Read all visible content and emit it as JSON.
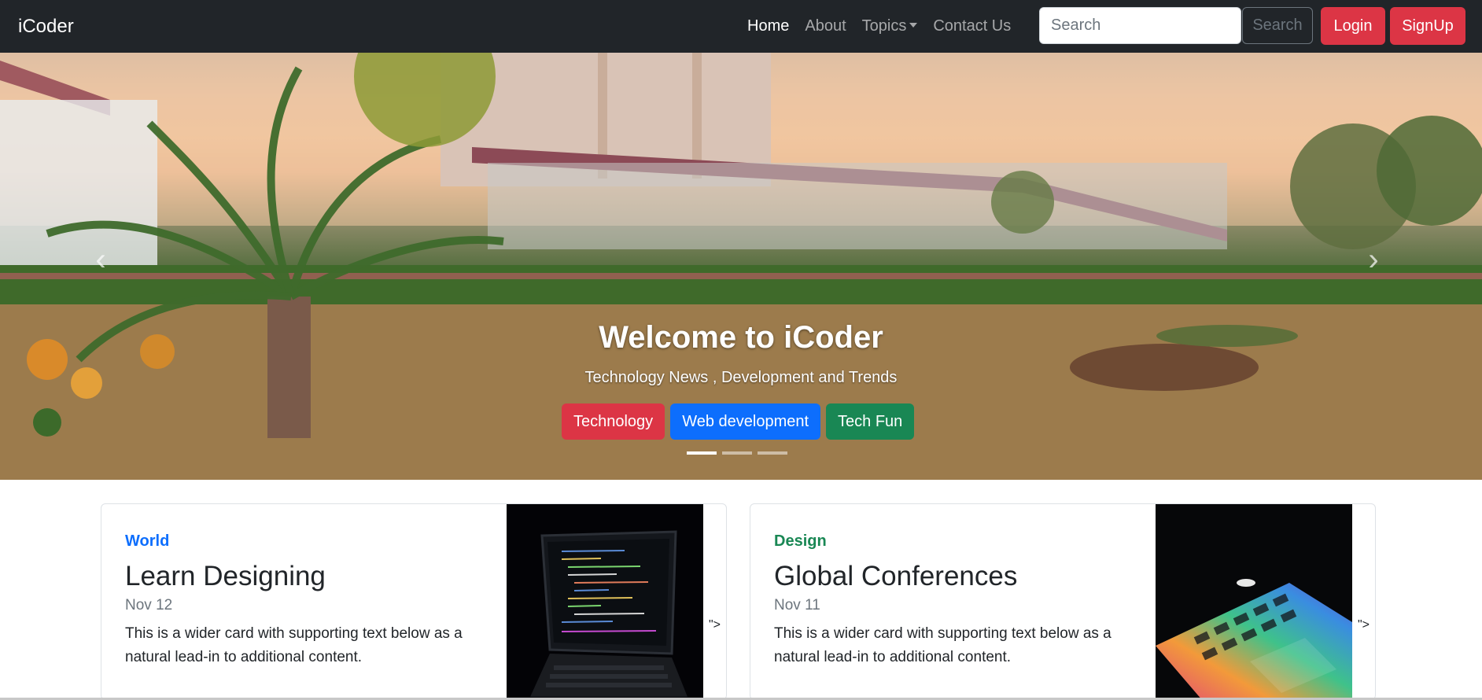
{
  "navbar": {
    "brand": "iCoder",
    "links": [
      {
        "label": "Home",
        "active": true
      },
      {
        "label": "About",
        "active": false
      },
      {
        "label": "Topics",
        "active": false,
        "dropdown": true
      },
      {
        "label": "Contact Us",
        "active": false
      }
    ],
    "search_placeholder": "Search",
    "search_button": "Search",
    "login": "Login",
    "signup": "SignUp"
  },
  "hero": {
    "title": "Welcome to iCoder",
    "subtitle": "Technology News , Development and Trends",
    "buttons": [
      {
        "label": "Technology",
        "color": "#dc3545"
      },
      {
        "label": "Web development",
        "color": "#0d6efd"
      },
      {
        "label": "Tech Fun",
        "color": "#198754"
      }
    ],
    "indicators_total": 3,
    "indicator_active": 1
  },
  "cards": [
    {
      "category": "World",
      "category_color": "#0d6efd",
      "title": "Learn Designing",
      "date": "Nov 12",
      "text": "This is a wider card with supporting text below as a natural lead-in to additional content.",
      "stray": "\">"
    },
    {
      "category": "Design",
      "category_color": "#198754",
      "title": "Global Conferences",
      "date": "Nov 11",
      "text": "This is a wider card with supporting text below as a natural lead-in to additional content.",
      "stray": "\">"
    }
  ],
  "colors": {
    "navbar_bg": "#212529",
    "danger": "#dc3545",
    "primary": "#0d6efd",
    "success": "#198754"
  }
}
